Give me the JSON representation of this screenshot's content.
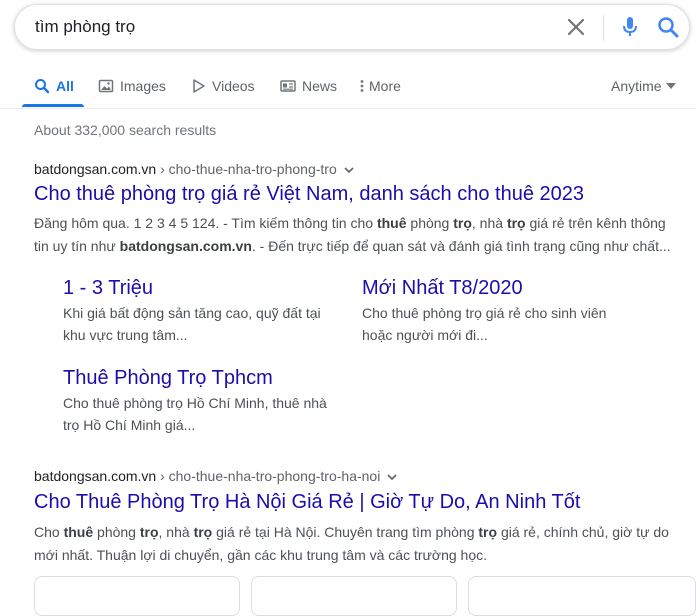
{
  "search": {
    "query": "tìm phòng trọ"
  },
  "tabs": [
    {
      "label": "All",
      "icon": "search-icon"
    },
    {
      "label": "Images",
      "icon": "image-icon"
    },
    {
      "label": "Videos",
      "icon": "play-icon"
    },
    {
      "label": "News",
      "icon": "news-icon"
    },
    {
      "label": "More",
      "icon": "more-vert-icon"
    }
  ],
  "anytime": "Anytime",
  "result_stats": "About 332,000 search results",
  "colors": {
    "accent": "#1a73e8",
    "link": "#1a0dab",
    "snippet": "#4d5156"
  },
  "result1": {
    "domain": "batdongsan.com.vn",
    "path": " › cho-thue-nha-tro-phong-tro",
    "title": "Cho thuê phòng trọ giá rẻ Việt Nam, danh sách cho thuê 2023",
    "snippet_line1": {
      "a": "Đăng hôm qua. 1 2 3 4 5 124. - Tìm kiếm thông tin cho ",
      "b1": "thuê",
      "c": " phòng ",
      "b2": "trọ",
      "d": ", nhà ",
      "b3": "trọ",
      "e": " giá rẻ trên kênh thông"
    },
    "snippet_line2": {
      "a": "tin uy tín như ",
      "b1": "batdongsan.com.vn",
      "c": ". - Đến trực tiếp để quan sát và đánh giá tình trạng cũng như chất..."
    },
    "sitelinks": [
      {
        "title": "1 - 3 Triệu",
        "line1": "Khi giá bất động sản tăng cao, quỹ đất tại",
        "line2": "khu vực trung tâm..."
      },
      {
        "title": "Mới Nhất T8/2020",
        "line1": "Cho thuê phòng trọ giá rẻ cho sinh viên",
        "line2": "hoặc người mới đi..."
      },
      {
        "title": "Thuê Phòng Trọ Tphcm",
        "line1": "Cho thuê phòng trọ Hồ Chí Minh, thuê nhà",
        "line2": "trọ Hồ Chí Minh giá..."
      }
    ]
  },
  "result2": {
    "domain": "batdongsan.com.vn",
    "path": " › cho-thue-nha-tro-phong-tro-ha-noi",
    "title": "Cho Thuê Phòng Trọ Hà Nội Giá Rẻ | Giờ Tự Do, An Ninh Tốt",
    "snippet_line1": {
      "a": "Cho ",
      "b1": "thuê",
      "c": " phòng ",
      "b2": "trọ",
      "d": ", nhà ",
      "b3": "trọ",
      "e": " giá rẻ tại Hà Nội. Chuyên trang tìm phòng ",
      "b4": "trọ",
      "f": " giá rẻ, chính chủ, giờ tự do"
    },
    "snippet_line2": "mới nhất. Thuận lợi di chuyển, gần các khu trung tâm và các trường học."
  }
}
